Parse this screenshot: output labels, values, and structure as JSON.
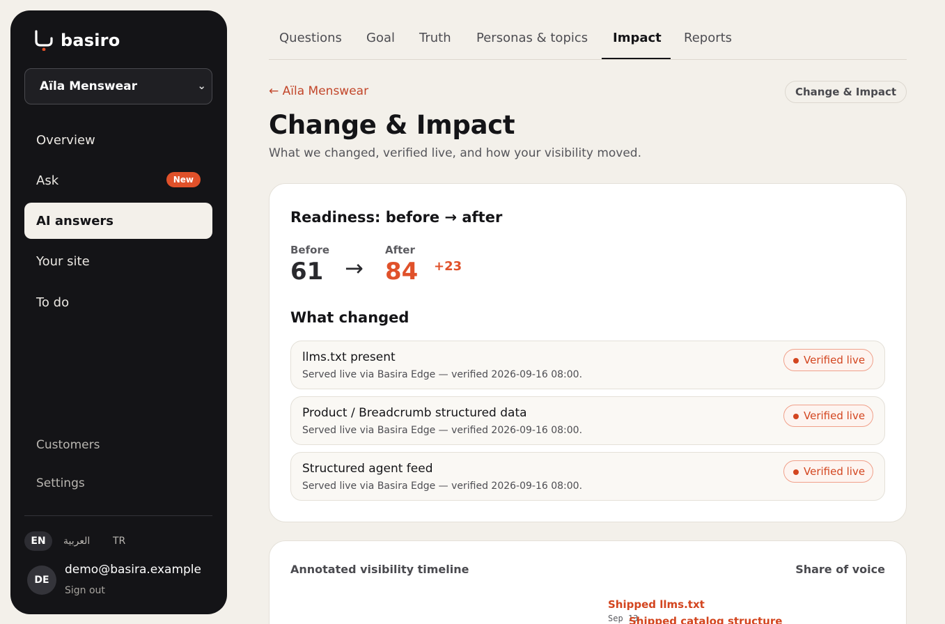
{
  "brand": {
    "name": "basiro"
  },
  "workspace": {
    "name": "Aïla Menswear"
  },
  "nav": {
    "items": [
      {
        "label": "Overview"
      },
      {
        "label": "Ask",
        "badge": "New"
      },
      {
        "label": "AI answers"
      },
      {
        "label": "Your site"
      },
      {
        "label": "To do"
      }
    ],
    "secondary": [
      {
        "label": "Customers"
      },
      {
        "label": "Settings"
      }
    ]
  },
  "languages": [
    "EN",
    "العربية",
    "TR"
  ],
  "user": {
    "initials": "DE",
    "email": "demo@basira.example",
    "signout": "Sign out"
  },
  "tabs": [
    "Questions",
    "Goal",
    "Truth",
    "Personas & topics",
    "Impact",
    "Reports"
  ],
  "header": {
    "back": "← Aïla Menswear",
    "chip": "Change & Impact",
    "title": "Change & Impact",
    "subtitle": "What we changed, verified live, and how your visibility moved."
  },
  "readiness": {
    "title": "Readiness: before → after",
    "before_label": "Before",
    "before": "61",
    "arrow": "→",
    "after_label": "After",
    "after": "84",
    "delta": "+23"
  },
  "changes": {
    "title": "What changed",
    "items": [
      {
        "title": "llms.txt present",
        "desc": "Served live via Basira Edge — verified 2026-09-16 08:00.",
        "status": "Verified live"
      },
      {
        "title": "Product / Breadcrumb structured data",
        "desc": "Served live via Basira Edge — verified 2026-09-16 08:00.",
        "status": "Verified live"
      },
      {
        "title": "Structured agent feed",
        "desc": "Served live via Basira Edge — verified 2026-09-16 08:00.",
        "status": "Verified live"
      }
    ]
  },
  "timeline": {
    "title": "Annotated visibility timeline",
    "metric": "Share of voice",
    "annotations": [
      {
        "label": "Shipped llms.txt",
        "date": "Sep 13"
      },
      {
        "label": "Shipped catalog structure"
      }
    ]
  },
  "colors": {
    "accent": "#e0512a",
    "sidebar": "#141417",
    "background": "#f3f0ea"
  }
}
